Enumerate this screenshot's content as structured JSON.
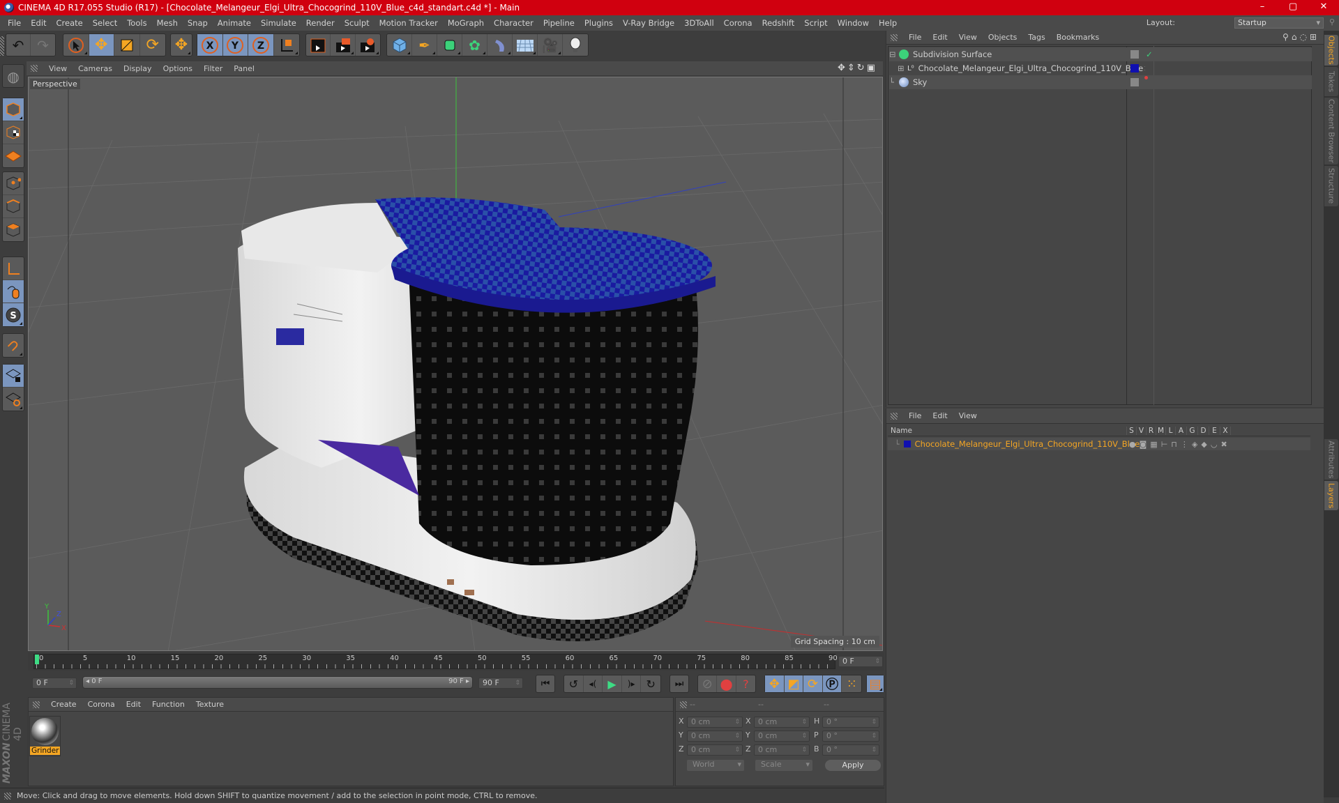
{
  "window": {
    "title": "CINEMA 4D R17.055 Studio (R17) - [Chocolate_Melangeur_Elgi_Ultra_Chocogrind_110V_Blue_c4d_standart.c4d *] - Main",
    "controls": {
      "minimize": "–",
      "maximize": "▢",
      "close": "✕"
    },
    "accent": "#d0000f"
  },
  "menubar": {
    "items": [
      "File",
      "Edit",
      "Create",
      "Select",
      "Tools",
      "Mesh",
      "Snap",
      "Animate",
      "Simulate",
      "Render",
      "Sculpt",
      "Motion Tracker",
      "MoGraph",
      "Character",
      "Pipeline",
      "Plugins",
      "V-Ray Bridge",
      "3DToAll",
      "Corona",
      "Redshift",
      "Script",
      "Window",
      "Help"
    ],
    "layout_label": "Layout:",
    "layout_value": "Startup"
  },
  "toolbar": {
    "groups": [
      [
        "undo-icon",
        "redo-icon"
      ],
      [
        "select-arrow-icon",
        "move-icon",
        "scale-icon",
        "rotate-icon"
      ],
      [
        "live-move-icon"
      ],
      [
        "x-axis-icon",
        "y-axis-icon",
        "z-axis-icon",
        "coordinate-system-icon"
      ],
      [
        "render-view-icon",
        "render-picture-viewer-icon",
        "render-settings-icon"
      ],
      [
        "cube-icon",
        "pen-spline-icon",
        "subdivision-icon",
        "array-icon",
        "deformer-icon",
        "floor-icon",
        "camera-icon",
        "light-icon"
      ]
    ],
    "axis_labels": {
      "x": "X",
      "y": "Y",
      "z": "Z"
    }
  },
  "left_tools": [
    "model-mode-icon",
    "texture-mode-icon",
    "workplane-mode-icon",
    "points-mode-icon",
    "edges-mode-icon",
    "polygons-mode-icon",
    "axis-mode-icon",
    "tweak-mode-icon",
    "snap-settings-icon",
    "magnet-icon",
    "workplane-lock-icon",
    "workplane-rotate-icon"
  ],
  "viewport": {
    "menu": [
      "View",
      "Cameras",
      "Display",
      "Options",
      "Filter",
      "Panel"
    ],
    "camera_label": "Perspective",
    "grid_spacing": "Grid Spacing : 10 cm",
    "axis": {
      "x": "X",
      "y": "Y",
      "z": "Z"
    },
    "nav_icons": [
      "pan-icon",
      "dolly-icon",
      "orbit-icon",
      "maximize-view-icon"
    ]
  },
  "object_manager": {
    "menu": [
      "File",
      "Edit",
      "View",
      "Objects",
      "Tags",
      "Bookmarks"
    ],
    "objects": [
      {
        "name": "Subdivision Surface",
        "icon": "subdivision-icon",
        "tag": "check"
      },
      {
        "name": "Chocolate_Melangeur_Elgi_Ultra_Chocogrind_110V_Blue",
        "icon": "null-object-icon",
        "color": "#1010b0"
      },
      {
        "name": "Sky",
        "icon": "sky-icon",
        "dot": "#e04040"
      }
    ]
  },
  "right_tabs": {
    "top": [
      "Objects",
      "Takes",
      "Content Browser",
      "Structure"
    ],
    "bottom": [
      "Attributes",
      "Layers"
    ]
  },
  "layer_manager": {
    "menu": [
      "File",
      "Edit",
      "View"
    ],
    "columns": [
      "Name",
      "S",
      "V",
      "R",
      "M",
      "L",
      "A",
      "G",
      "D",
      "E",
      "X"
    ],
    "layers": [
      {
        "name": "Chocolate_Melangeur_Elgi_Ultra_Chocogrind_110V_Blue",
        "color": "#1010b0",
        "text_color": "#f5a623"
      }
    ]
  },
  "timeline": {
    "ticks": [
      "0",
      "5",
      "10",
      "15",
      "20",
      "25",
      "30",
      "35",
      "40",
      "45",
      "50",
      "55",
      "60",
      "65",
      "70",
      "75",
      "80",
      "85",
      "90"
    ],
    "current_frame": "0 F",
    "start_field": "0 F",
    "range_start": "0 F",
    "range_end": "90 F",
    "end_field": "90 F"
  },
  "transport": {
    "buttons": [
      "go-to-start-icon",
      "previous-key-icon",
      "previous-frame-icon",
      "play-icon",
      "next-frame-icon",
      "next-key-icon",
      "go-to-end-icon",
      "record-disabled-icon",
      "autokey-icon",
      "keyframe-selection-icon",
      "move-key-icon",
      "scale-key-icon",
      "rotate-key-icon",
      "param-key-icon",
      "pla-key-icon",
      "timeline-icon"
    ]
  },
  "material_manager": {
    "menu": [
      "Create",
      "Corona",
      "Edit",
      "Function",
      "Texture"
    ],
    "materials": [
      {
        "name": "Grinder"
      }
    ]
  },
  "coordinates": {
    "headers": [
      "--",
      "--",
      "--"
    ],
    "rows": [
      {
        "l1": "X",
        "v1": "0 cm",
        "l2": "X",
        "v2": "0 cm",
        "l3": "H",
        "v3": "0 °"
      },
      {
        "l1": "Y",
        "v1": "0 cm",
        "l2": "Y",
        "v2": "0 cm",
        "l3": "P",
        "v3": "0 °"
      },
      {
        "l1": "Z",
        "v1": "0 cm",
        "l2": "Z",
        "v2": "0 cm",
        "l3": "B",
        "v3": "0 °"
      }
    ],
    "mode_select": "World",
    "type_select": "Scale",
    "apply": "Apply"
  },
  "branding": {
    "maxon": "MAXON",
    "product": "CINEMA 4D"
  },
  "status": "Move: Click and drag to move elements. Hold down SHIFT to quantize movement / add to the selection in point mode, CTRL to remove."
}
